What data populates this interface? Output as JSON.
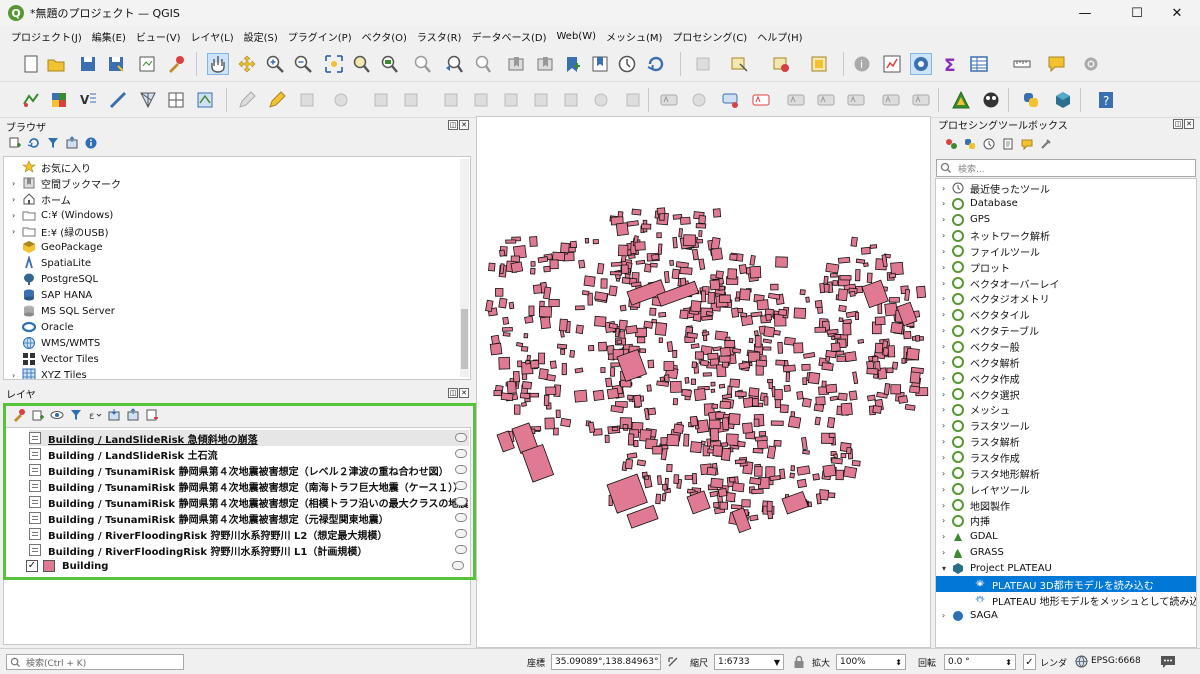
{
  "window": {
    "title": "*無題のプロジェクト — QGIS",
    "min": "—",
    "max": "☐",
    "close": "✕"
  },
  "menu": [
    "プロジェクト(J)",
    "編集(E)",
    "ビュー(V)",
    "レイヤ(L)",
    "設定(S)",
    "プラグイン(P)",
    "ベクタ(O)",
    "ラスタ(R)",
    "データベース(D)",
    "Web(W)",
    "メッシュ(M)",
    "プロセシング(C)",
    "ヘルプ(H)"
  ],
  "browser": {
    "title": "ブラウザ",
    "items": [
      {
        "label": "お気に入り",
        "icon": "star-icon",
        "arrow": ""
      },
      {
        "label": "空間ブックマーク",
        "icon": "bookmark-icon",
        "arrow": "›"
      },
      {
        "label": "ホーム",
        "icon": "home-icon",
        "arrow": "›"
      },
      {
        "label": "C:¥ (Windows)",
        "icon": "folder-icon",
        "arrow": "›"
      },
      {
        "label": "E:¥ (緑のUSB)",
        "icon": "folder-icon",
        "arrow": "›"
      },
      {
        "label": "GeoPackage",
        "icon": "geopackage-icon",
        "arrow": ""
      },
      {
        "label": "SpatiaLite",
        "icon": "spatialite-icon",
        "arrow": ""
      },
      {
        "label": "PostgreSQL",
        "icon": "postgresql-icon",
        "arrow": ""
      },
      {
        "label": "SAP HANA",
        "icon": "sap-hana-icon",
        "arrow": ""
      },
      {
        "label": "MS SQL Server",
        "icon": "mssql-icon",
        "arrow": ""
      },
      {
        "label": "Oracle",
        "icon": "oracle-icon",
        "arrow": ""
      },
      {
        "label": "WMS/WMTS",
        "icon": "wms-icon",
        "arrow": ""
      },
      {
        "label": "Vector Tiles",
        "icon": "vector-tiles-icon",
        "arrow": ""
      },
      {
        "label": "XYZ Tiles",
        "icon": "xyz-tiles-icon",
        "arrow": "›"
      }
    ]
  },
  "layers": {
    "title": "レイヤ",
    "items": [
      {
        "label": "Building / LandSlideRisk 急傾斜地の崩落",
        "underline": true,
        "selected": true
      },
      {
        "label": "Building / LandSlideRisk 土石流"
      },
      {
        "label": "Building / TsunamiRisk 静岡県第４次地震被害想定（レベル２津波の重ね合わせ図）"
      },
      {
        "label": "Building / TsunamiRisk 静岡県第４次地震被害想定（南海トラフ巨大地震（ケース１））"
      },
      {
        "label": "Building / TsunamiRisk 静岡県第４次地震被害想定（相模トラフ沿いの最大クラスの地震（ケー"
      },
      {
        "label": "Building / TsunamiRisk 静岡県第４次地震被害想定（元禄型関東地震）"
      },
      {
        "label": "Building / RiverFloodingRisk 狩野川水系狩野川 L2（想定最大規模）"
      },
      {
        "label": "Building / RiverFloodingRisk 狩野川水系狩野川 L1（計画規模）"
      }
    ],
    "building": {
      "label": "Building",
      "checked": "✓",
      "color": "#e07a92"
    }
  },
  "highlight_color": "#56c43b",
  "building_fill": "#e07a92",
  "processing": {
    "title": "プロセシングツールボックス",
    "search_placeholder": "検索...",
    "items": [
      {
        "label": "最近使ったツール",
        "icon": "clock-icon"
      },
      {
        "label": "Database",
        "icon": "qgis-icon"
      },
      {
        "label": "GPS",
        "icon": "qgis-icon"
      },
      {
        "label": "ネットワーク解析",
        "icon": "qgis-icon"
      },
      {
        "label": "ファイルツール",
        "icon": "qgis-icon"
      },
      {
        "label": "プロット",
        "icon": "qgis-icon"
      },
      {
        "label": "ベクタオーバーレイ",
        "icon": "qgis-icon"
      },
      {
        "label": "ベクタジオメトリ",
        "icon": "qgis-icon"
      },
      {
        "label": "ベクタタイル",
        "icon": "qgis-icon"
      },
      {
        "label": "ベクタテーブル",
        "icon": "qgis-icon"
      },
      {
        "label": "ベクター般",
        "icon": "qgis-icon"
      },
      {
        "label": "ベクタ解析",
        "icon": "qgis-icon"
      },
      {
        "label": "ベクタ作成",
        "icon": "qgis-icon"
      },
      {
        "label": "ベクタ選択",
        "icon": "qgis-icon"
      },
      {
        "label": "メッシュ",
        "icon": "qgis-icon"
      },
      {
        "label": "ラスタツール",
        "icon": "qgis-icon"
      },
      {
        "label": "ラスタ解析",
        "icon": "qgis-icon"
      },
      {
        "label": "ラスタ作成",
        "icon": "qgis-icon"
      },
      {
        "label": "ラスタ地形解析",
        "icon": "qgis-icon"
      },
      {
        "label": "レイヤツール",
        "icon": "qgis-icon"
      },
      {
        "label": "地図製作",
        "icon": "qgis-icon"
      },
      {
        "label": "内挿",
        "icon": "qgis-icon"
      },
      {
        "label": "GDAL",
        "icon": "gdal-icon"
      },
      {
        "label": "GRASS",
        "icon": "grass-icon"
      },
      {
        "label": "Project PLATEAU",
        "icon": "plateau-icon",
        "expanded": true
      },
      {
        "label": "PLATEAU 3D都市モデルを読み込む",
        "icon": "gear-icon",
        "child": true,
        "selected": true
      },
      {
        "label": "PLATEAU 地形モデルをメッシュとして読み込む",
        "icon": "gear-icon",
        "child": true
      },
      {
        "label": "SAGA",
        "icon": "saga-icon"
      }
    ]
  },
  "status": {
    "search_placeholder": "検索(Ctrl + K)",
    "coord_label": "座標",
    "coord_value": "35.09089°,138.84963°",
    "scale_label": "縮尺",
    "scale_value": "1:6733",
    "magnifier_label": "拡大",
    "magnifier_value": "100%",
    "rotation_label": "回転",
    "rotation_value": "0.0 °",
    "render_label": "レンダ",
    "render_checked": "✓",
    "crs": "EPSG:6668"
  }
}
